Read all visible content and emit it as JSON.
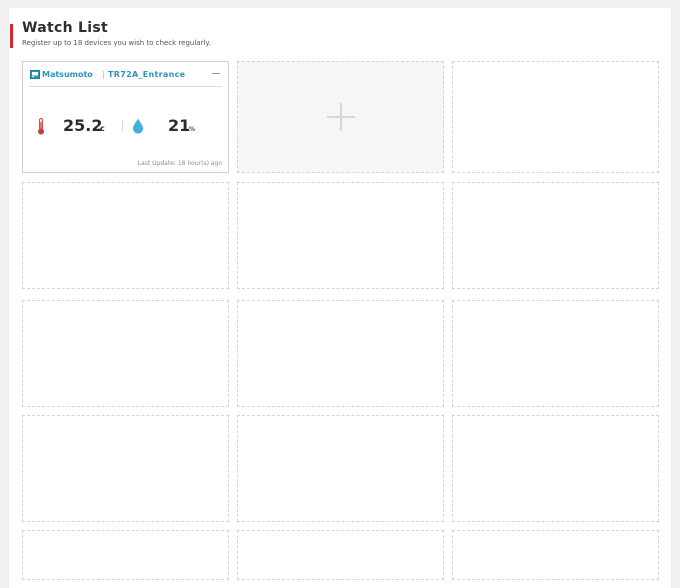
{
  "header": {
    "title": "Watch List",
    "subtitle": "Register up to 18 devices you wish to check regularly."
  },
  "colors": {
    "accent": "#d8262f",
    "link": "#2a96b8",
    "temperature_icon": "#cf3b35",
    "humidity_icon": "#3cb1de"
  },
  "device_card": {
    "icon": "device-icon",
    "group": "Matsumoto",
    "separator": "|",
    "device": "TR72A_Entrance",
    "remove_icon": "minus-icon",
    "temperature": {
      "icon": "thermometer-icon",
      "value": "25.2",
      "unit": "c"
    },
    "humidity": {
      "icon": "water-drop-icon",
      "value": "21",
      "unit": "%"
    },
    "last_update": "Last Update: 18 hour(s) ago"
  },
  "add_slot": {
    "icon": "plus-icon"
  }
}
